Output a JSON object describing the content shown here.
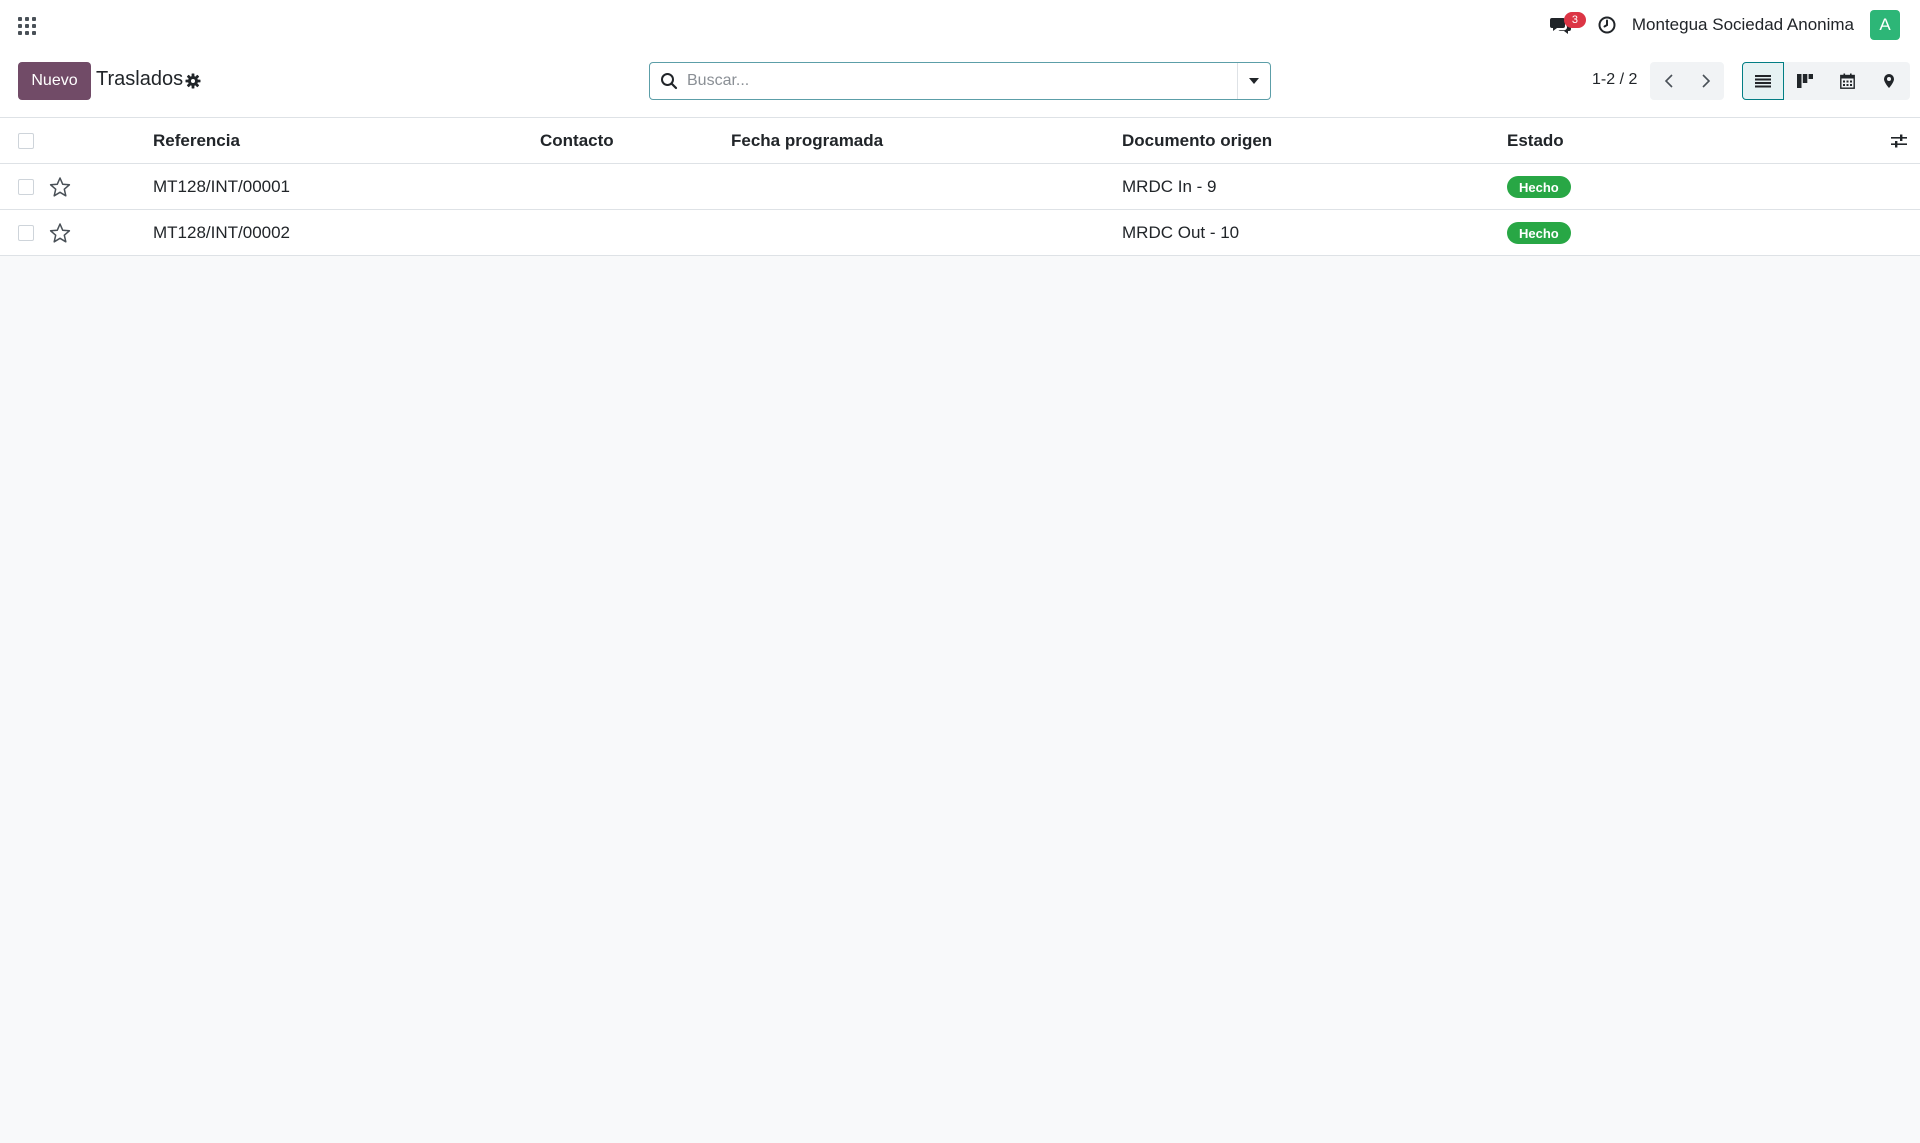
{
  "navbar": {
    "apps_icon": "apps-grid-icon",
    "messages_count": "3",
    "company_name": "Montegua Sociedad Anonima",
    "avatar_letter": "A",
    "avatar_color": "#2db677"
  },
  "control_panel": {
    "new_button": "Nuevo",
    "title": "Traslados",
    "search_placeholder": "Buscar...",
    "pager": "1-2 / 2",
    "brand_color": "#714b67"
  },
  "table": {
    "columns": [
      "Referencia",
      "Contacto",
      "Fecha programada",
      "Documento origen",
      "Estado"
    ],
    "rows": [
      {
        "reference": "MT128/INT/00001",
        "contact": "",
        "scheduled_date": "",
        "source_document": "MRDC In - 9",
        "status": "Hecho"
      },
      {
        "reference": "MT128/INT/00002",
        "contact": "",
        "scheduled_date": "",
        "source_document": "MRDC Out - 10",
        "status": "Hecho"
      }
    ],
    "status_color": "#28a745"
  }
}
